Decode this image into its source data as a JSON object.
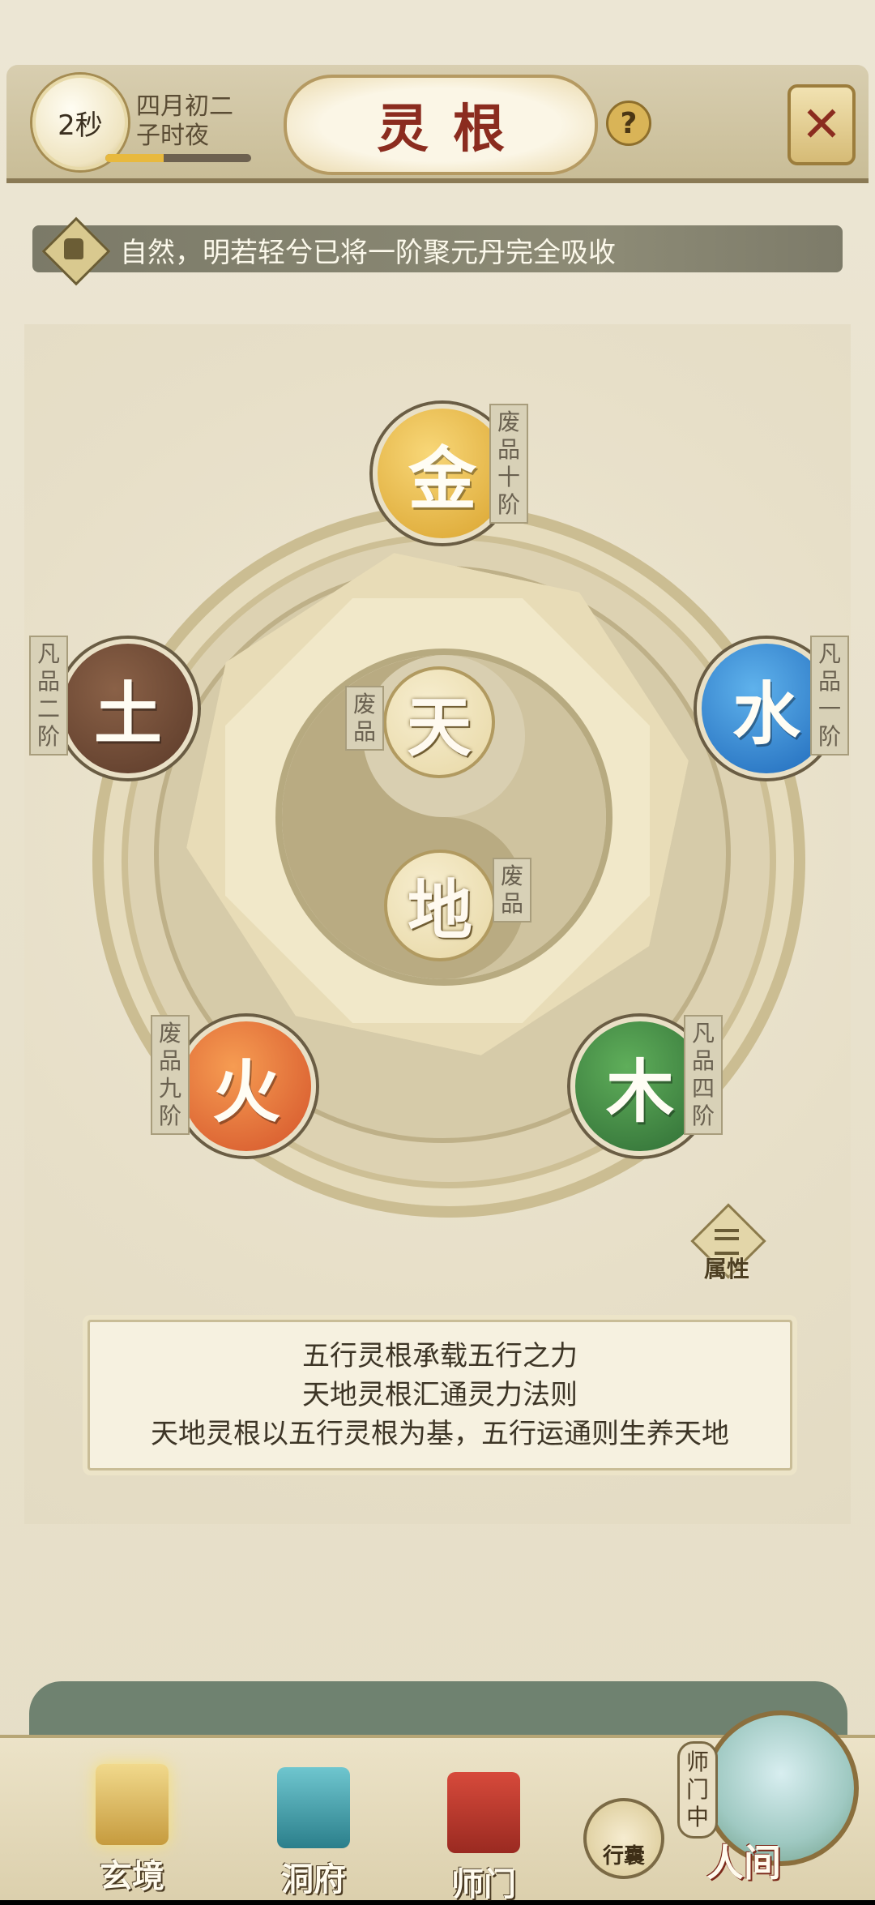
{
  "header": {
    "timer": "2秒",
    "date_line1": "四月初二",
    "date_line2": "子时夜",
    "time_progress": 0.4,
    "title": "灵根",
    "help_label": "?",
    "close_label": "✕"
  },
  "notice": {
    "text": "自然，明若轻兮已将一阶聚元丹完全吸收"
  },
  "elements": {
    "jin": {
      "label": "金",
      "grade": "废品十阶"
    },
    "tu": {
      "label": "土",
      "grade": "凡品二阶"
    },
    "shui": {
      "label": "水",
      "grade": "凡品一阶"
    },
    "huo": {
      "label": "火",
      "grade": "废品九阶"
    },
    "mu": {
      "label": "木",
      "grade": "凡品四阶"
    },
    "tian": {
      "label": "天",
      "grade": "废品"
    },
    "di": {
      "label": "地",
      "grade": "废品"
    }
  },
  "attributes_button": "属性",
  "info": {
    "line1": "五行灵根承载五行之力",
    "line2": "天地灵根汇通灵力法则",
    "line3": "天地灵根以五行灵根为基，五行运通则生养天地"
  },
  "nav": {
    "xuanjing": "玄境",
    "dongfu": "洞府",
    "shimen": "师门",
    "bag": "行囊",
    "renjian": "人间",
    "shimen_status": "师门中"
  },
  "colors": {
    "title": "#8b2c1f",
    "jin": "#e5b13f",
    "tu": "#6d4a35",
    "shui": "#2e7fd0",
    "huo": "#e06a34",
    "mu": "#3d8a42"
  }
}
